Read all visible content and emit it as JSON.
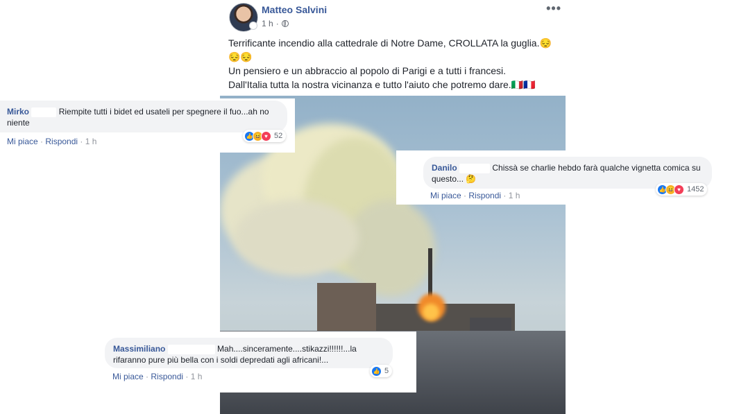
{
  "post": {
    "author": "Matteo Salvini",
    "time": "1 h",
    "more": "•••",
    "text_lines": [
      "Terrificante incendio alla cattedrale di Notre Dame, CROLLATA la guglia.😔",
      "😔😔",
      "Un pensiero e un abbraccio al popolo di Parigi e a tutti i francesi.",
      "Dall'Italia tutta la nostra vicinanza e tutto l'aiuto che potremo dare.🇮🇹🇫🇷"
    ]
  },
  "comments": [
    {
      "name": "Mirko",
      "text": "Riempite tutti i bidet ed usateli per spegnere il fuo...ah no niente",
      "reaction_count": "52",
      "like": "Mi piace",
      "reply": "Rispondi",
      "time": "1 h"
    },
    {
      "name": "Danilo",
      "text": "Chissà se charlie hebdo farà qualche vignetta comica su questo... 🤔",
      "reaction_count": "1452",
      "like": "Mi piace",
      "reply": "Rispondi",
      "time": "1 h"
    },
    {
      "name": "Massimiliano",
      "text": "Mah....sinceramente....stikazzi!!!!!!...la rifaranno pure più bella con i soldi depredati agli africani!...",
      "reaction_count": "5",
      "like": "Mi piace",
      "reply": "Rispondi",
      "time": "1 h"
    }
  ],
  "colors": {
    "link_blue": "#385898",
    "bubble_bg": "#f2f3f5",
    "like_blue": "#1877f2",
    "haha_yellow": "#f7b125",
    "love_red": "#f33e58"
  },
  "icons": [
    "globe-icon",
    "like-reaction-icon",
    "haha-reaction-icon",
    "love-reaction-icon",
    "more-options-icon"
  ]
}
